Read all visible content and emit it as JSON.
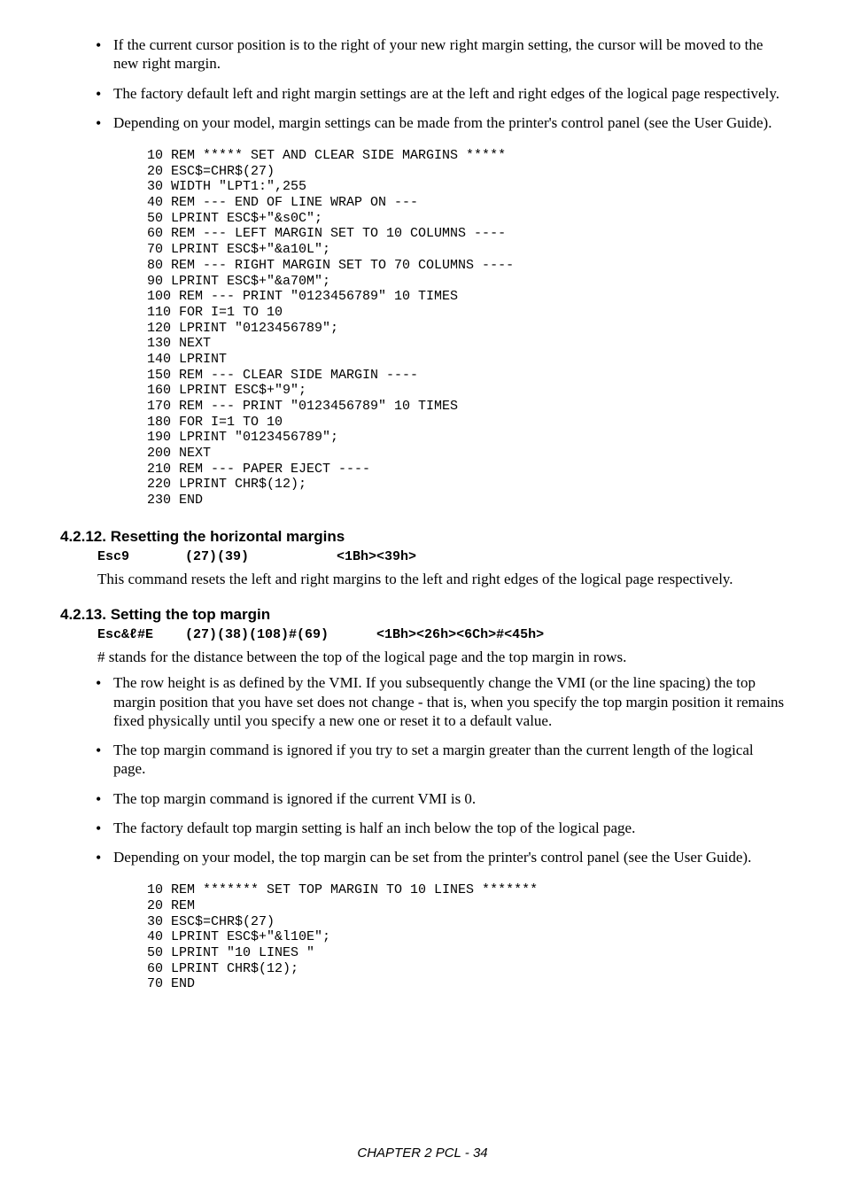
{
  "bullets_top": [
    "If the current cursor position is to the right of your new right margin setting, the cursor will be moved to the new right margin.",
    "The factory default left and right margin settings are at the left and right edges of the logical page respectively.",
    "Depending on your model,  margin settings can be made from the printer's control panel (see the User Guide)."
  ],
  "code1": "10 REM ***** SET AND CLEAR SIDE MARGINS *****\n20 ESC$=CHR$(27)\n30 WIDTH \"LPT1:\",255\n40 REM --- END OF LINE WRAP ON ---\n50 LPRINT ESC$+\"&s0C\";\n60 REM --- LEFT MARGIN SET TO 10 COLUMNS ----\n70 LPRINT ESC$+\"&a10L\";\n80 REM --- RIGHT MARGIN SET TO 70 COLUMNS ----\n90 LPRINT ESC$+\"&a70M\";\n100 REM --- PRINT \"0123456789\" 10 TIMES\n110 FOR I=1 TO 10\n120 LPRINT \"0123456789\";\n130 NEXT\n140 LPRINT\n150 REM --- CLEAR SIDE MARGIN ----\n160 LPRINT ESC$+\"9\";\n170 REM --- PRINT \"0123456789\" 10 TIMES\n180 FOR I=1 TO 10\n190 LPRINT \"0123456789\";\n200 NEXT\n210 REM --- PAPER EJECT ----\n220 LPRINT CHR$(12);\n230 END",
  "section_12": {
    "title": "4.2.12.  Resetting the horizontal margins",
    "cmd": "Esc9       (27)(39)           <1Bh><39h>",
    "text": "This command resets the left and right margins to the left and right edges of the logical page respectively."
  },
  "section_13": {
    "title": "4.2.13.  Setting the top margin",
    "cmd": "Esc&ℓ#E    (27)(38)(108)#(69)      <1Bh><26h><6Ch>#<45h>",
    "intro": "# stands for the distance between the top of the logical page and the top margin in rows.",
    "bullets": [
      "The row height is as defined by the VMI. If you subsequently change the VMI (or the line spacing) the top margin position that you have set does not change - that is, when you specify the top margin position it remains fixed physically until you specify a new one or reset it to a default value.",
      "The top margin command is ignored if you try to set a margin greater than the current length of the logical page.",
      "The top margin command is ignored if the current VMI is 0.",
      "The factory default top margin setting is half an inch below the top of the logical page.",
      "Depending on your model,  the top margin can be set from the printer's control panel (see the User Guide)."
    ]
  },
  "code2": "10 REM ******* SET TOP MARGIN TO 10 LINES *******\n20 REM\n30 ESC$=CHR$(27)\n40 LPRINT ESC$+\"&l10E\";\n50 LPRINT \"10 LINES \"\n60 LPRINT CHR$(12);\n70 END",
  "footer": "CHAPTER 2 PCL - 34"
}
